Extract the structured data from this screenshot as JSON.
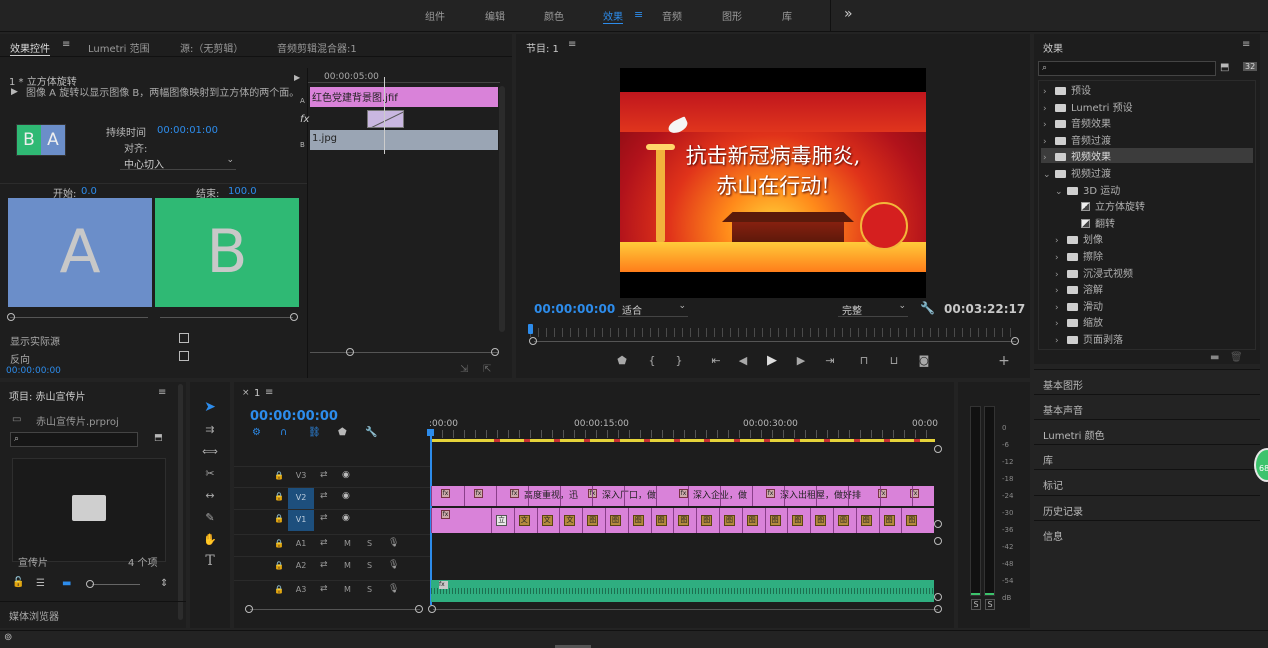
{
  "workspace": {
    "tabs": [
      "组件",
      "编辑",
      "颜色",
      "效果",
      "音频",
      "图形",
      "库"
    ],
    "active": "效果",
    "more": "»"
  },
  "effect_controls": {
    "tabs": [
      "效果控件",
      "Lumetri 范围",
      "源:（无剪辑）",
      "音频剪辑混合器:1"
    ],
    "clip_name": "1 * 立方体旋转",
    "description": "图像 A 旋转以显示图像 B，两幅图像映射到立方体的两个面。",
    "duration_label": "持续时间",
    "duration_value": "00:00:01:00",
    "align_label": "对齐:",
    "align_value": "中心切入",
    "start_label": "开始:",
    "start_value": "0.0",
    "end_label": "结束:",
    "end_value": "100.0",
    "a_label": "A",
    "b_label": "B",
    "show_actual": "显示实际源",
    "reverse": "反向",
    "timecode": "00:00:00:00",
    "mini_timeline": {
      "time": "00:00:05:00",
      "track_a_label": "A",
      "track_b_label": "B",
      "fx_label": "fx",
      "clip_a": "红色党建背景图.jfif",
      "clip_b": "1.jpg"
    }
  },
  "program_monitor": {
    "title": "节目: 1",
    "timecode": "00:00:00:00",
    "fit": "适合",
    "quality": "完整",
    "duration": "00:03:22:17",
    "frame_line1": "抗击新冠病毒肺炎,",
    "frame_line2": "赤山在行动!"
  },
  "effects_panel": {
    "title": "效果",
    "items": [
      {
        "label": "预设",
        "level": 0,
        "open": false
      },
      {
        "label": "Lumetri 预设",
        "level": 0,
        "open": false
      },
      {
        "label": "音频效果",
        "level": 0,
        "open": false
      },
      {
        "label": "音频过渡",
        "level": 0,
        "open": false
      },
      {
        "label": "视频效果",
        "level": 0,
        "open": false,
        "selected": true
      },
      {
        "label": "视频过渡",
        "level": 0,
        "open": true
      },
      {
        "label": "3D 运动",
        "level": 1,
        "open": true
      },
      {
        "label": "立方体旋转",
        "level": 2,
        "leaf": true
      },
      {
        "label": "翻转",
        "level": 2,
        "leaf": true
      },
      {
        "label": "划像",
        "level": 1,
        "open": false
      },
      {
        "label": "擦除",
        "level": 1,
        "open": false
      },
      {
        "label": "沉浸式视频",
        "level": 1,
        "open": false
      },
      {
        "label": "溶解",
        "level": 1,
        "open": false
      },
      {
        "label": "滑动",
        "level": 1,
        "open": false
      },
      {
        "label": "缩放",
        "level": 1,
        "open": false
      },
      {
        "label": "页面剥落",
        "level": 1,
        "open": false
      }
    ],
    "sections": [
      "基本图形",
      "基本声音",
      "Lumetri 颜色",
      "库",
      "标记",
      "历史记录",
      "信息"
    ],
    "badge": "68"
  },
  "project": {
    "title": "项目: 赤山宣传片",
    "file": "赤山宣传片.prproj",
    "bin_label": "宣传片",
    "item_count": "4 个项",
    "media_browser": "媒体浏览器"
  },
  "timeline": {
    "sequence": "1",
    "timecode": "00:00:00:00",
    "ruler": [
      ":00:00",
      "00:00:15:00",
      "00:00:30:00",
      "00:00"
    ],
    "tracks": [
      {
        "name": "V3"
      },
      {
        "name": "V2"
      },
      {
        "name": "V1"
      },
      {
        "name": "A1",
        "m": "M",
        "s": "S"
      },
      {
        "name": "A2",
        "m": "M",
        "s": "S"
      },
      {
        "name": "A3",
        "m": "M",
        "s": "S"
      }
    ],
    "v2_texts": [
      "高度重视，迅",
      "深入厂口，做",
      "深入企业，做",
      "深入出租屋，做好排"
    ],
    "v1_glyphs": [
      "立",
      "文",
      "文",
      "文",
      "图",
      "图",
      "图",
      "图",
      "图",
      "图",
      "图",
      "图",
      "图",
      "图",
      "图",
      "图",
      "图",
      "图",
      "图"
    ]
  },
  "meter": {
    "scale": [
      "0",
      "-6",
      "-12",
      "-18",
      "-24",
      "-30",
      "-36",
      "-42",
      "-48",
      "-54",
      "dB"
    ],
    "solo": [
      "S",
      "S"
    ]
  },
  "colors": {
    "accent": "#2d8ceb",
    "clip_pink": "#d982d9",
    "audio_green": "#2fae80",
    "transition_b": "#2fb974",
    "transition_a": "#6b8ec9"
  }
}
